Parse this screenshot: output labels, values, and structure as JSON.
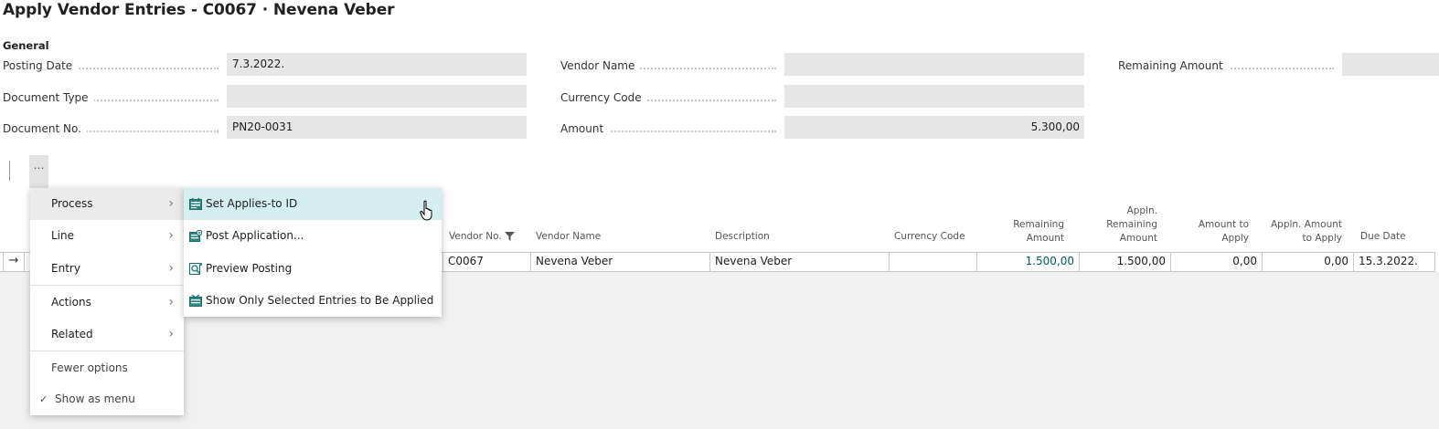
{
  "page": {
    "title": "Apply Vendor Entries - C0067 · Nevena Veber",
    "section": "General"
  },
  "fields": {
    "posting_date": {
      "label": "Posting Date",
      "value": "7.3.2022."
    },
    "document_type": {
      "label": "Document Type",
      "value": ""
    },
    "document_no": {
      "label": "Document No.",
      "value": "PN20-0031"
    },
    "vendor_name": {
      "label": "Vendor Name",
      "value": ""
    },
    "currency_code": {
      "label": "Currency Code",
      "value": ""
    },
    "amount": {
      "label": "Amount",
      "value": "5.300,00"
    },
    "remaining_amount": {
      "label": "Remaining Amount",
      "value": ""
    }
  },
  "toolbar": {
    "more_label": "⋯"
  },
  "menu": {
    "items": [
      {
        "label": "Process",
        "chevron": "›"
      },
      {
        "label": "Line",
        "chevron": "›"
      },
      {
        "label": "Entry",
        "chevron": "›"
      },
      {
        "label": "Actions",
        "chevron": "›"
      },
      {
        "label": "Related",
        "chevron": "›"
      }
    ],
    "fewer_options": "Fewer options",
    "show_as_menu": "Show as menu",
    "check": "✓"
  },
  "submenu": {
    "items": [
      {
        "label": "Set Applies-to ID",
        "icon": "set-applies-icon"
      },
      {
        "label": "Post Application...",
        "icon": "post-application-icon"
      },
      {
        "label": "Preview Posting",
        "icon": "preview-posting-icon"
      },
      {
        "label": "Show Only Selected Entries to Be Applied",
        "icon": "show-selected-icon"
      }
    ]
  },
  "table": {
    "headers": {
      "vendor_no": "Vendor No.",
      "vendor_name": "Vendor Name",
      "description": "Description",
      "currency_code": "Currency Code",
      "remaining_amount_1": "Remaining",
      "remaining_amount_2": "Amount",
      "appln_remaining_1": "Appln.",
      "appln_remaining_2": "Remaining",
      "appln_remaining_3": "Amount",
      "amount_to_apply_1": "Amount to",
      "amount_to_apply_2": "Apply",
      "appln_amount_to_apply_1": "Appln. Amount",
      "appln_amount_to_apply_2": "to Apply",
      "due_date": "Due Date"
    },
    "row": {
      "arrow": "→",
      "vendor_no": "C0067",
      "vendor_name": "Nevena Veber",
      "description": "Nevena Veber",
      "currency_code": "",
      "remaining_amount": "1.500,00",
      "appln_remaining_amount": "1.500,00",
      "amount_to_apply": "0,00",
      "appln_amount_to_apply": "0,00",
      "due_date": "15.3.2022."
    }
  },
  "colors": {
    "accent": "#00605f",
    "hover": "#d5eef0",
    "field_bg": "#e6e6e6"
  }
}
